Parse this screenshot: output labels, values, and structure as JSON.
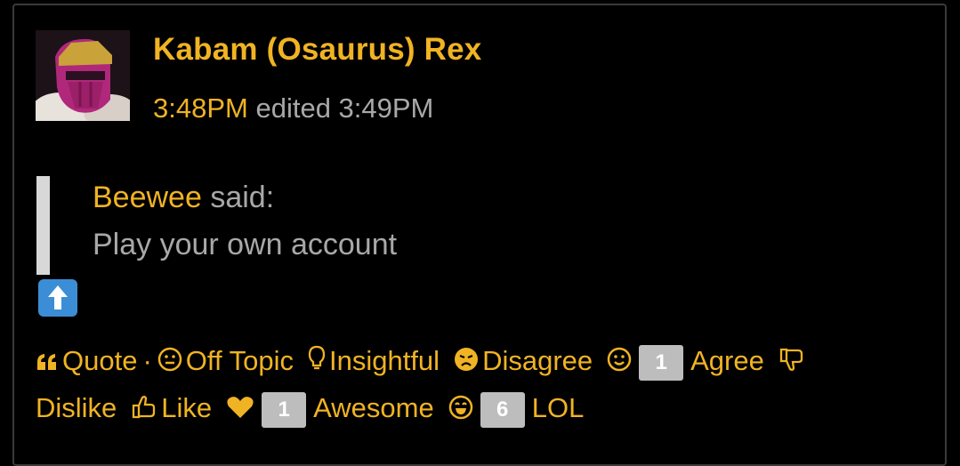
{
  "author": {
    "name": "Kabam (Osaurus) Rex",
    "time": "3:48PM",
    "edited": "edited 3:49PM"
  },
  "quote": {
    "author": "Beewee",
    "said": "said:",
    "text": "Play your own account"
  },
  "body": {
    "emoji": "up-arrow-emoji"
  },
  "reactions": {
    "quote": "Quote",
    "separator": "·",
    "off_topic": "Off Topic",
    "insightful": "Insightful",
    "disagree": "Disagree",
    "agree_count": "1",
    "agree": "Agree",
    "dislike": "Dislike",
    "like": "Like",
    "awesome_count": "1",
    "awesome": "Awesome",
    "lol_count": "6",
    "lol": "LOL"
  },
  "colors": {
    "accent": "#f0b323",
    "muted_text": "#a8a8a8",
    "background": "#000000",
    "badge": "#bdbdbd"
  }
}
